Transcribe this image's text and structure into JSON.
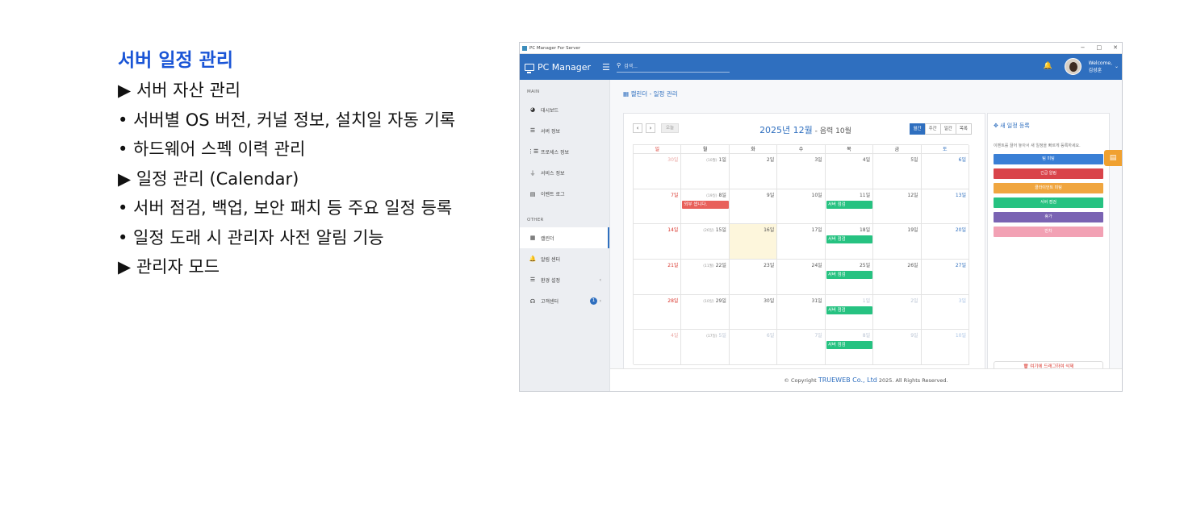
{
  "left_panel": {
    "title": "서버 일정 관리",
    "lines": [
      "▶ 서버 자산 관리",
      "• 서버별 OS 버전, 커널 정보, 설치일 자동 기록",
      "• 하드웨어 스펙 이력 관리",
      "▶ 일정 관리 (Calendar)",
      "• 서버 점검, 백업, 보안 패치 등 주요 일정 등록",
      "• 일정 도래 시 관리자 사전 알림 기능",
      "▶ 관리자 모드"
    ]
  },
  "window": {
    "title": "PC Manager For Server",
    "controls": [
      "−",
      "□",
      "✕"
    ]
  },
  "header": {
    "brand": "PC Manager",
    "search_placeholder": "검색...",
    "welcome": "Welcome,",
    "user": "김성훈"
  },
  "sidebar": {
    "main_label": "MAIN",
    "main_items": [
      {
        "label": "대시보드",
        "icon": "dashboard-icon",
        "glyph": "◕"
      },
      {
        "label": "서버 정보",
        "icon": "server-icon",
        "glyph": "☰"
      },
      {
        "label": "프로세스 정보",
        "icon": "list-icon",
        "glyph": "⋮☰"
      },
      {
        "label": "서비스 정보",
        "icon": "plug-icon",
        "glyph": "⏚"
      },
      {
        "label": "이벤트 로그",
        "icon": "log-icon",
        "glyph": "▤"
      }
    ],
    "other_label": "OTHER",
    "other_items": [
      {
        "label": "캘린더",
        "icon": "calendar-icon",
        "glyph": "▦",
        "active": true
      },
      {
        "label": "알림 센터",
        "icon": "bell-icon",
        "glyph": "🔔"
      },
      {
        "label": "환경 설정",
        "icon": "settings-icon",
        "glyph": "☰",
        "chevron": "‹"
      },
      {
        "label": "고객센터",
        "icon": "headset-icon",
        "glyph": "☊",
        "chevron": "‹",
        "badge": "1"
      }
    ]
  },
  "breadcrumb": "캘린더 - 일정 관리",
  "calendar": {
    "prev": "‹",
    "next": "›",
    "today": "오늘",
    "title": "2025년 12월",
    "lunar": " - 음력 10월",
    "views": [
      "월간",
      "주간",
      "일간",
      "목록"
    ],
    "active_view": "월간",
    "weekdays": [
      "일",
      "월",
      "화",
      "수",
      "목",
      "금",
      "토"
    ],
    "weeks": [
      [
        {
          "d": "30일",
          "om": true
        },
        {
          "d": "1일",
          "l": "(10월)"
        },
        {
          "d": "2일"
        },
        {
          "d": "3일"
        },
        {
          "d": "4일"
        },
        {
          "d": "5일"
        },
        {
          "d": "6일"
        }
      ],
      [
        {
          "d": "7일"
        },
        {
          "d": "8일",
          "l": "(19일)"
        },
        {
          "d": "9일"
        },
        {
          "d": "10일"
        },
        {
          "d": "11일"
        },
        {
          "d": "12일"
        },
        {
          "d": "13일"
        }
      ],
      [
        {
          "d": "14일"
        },
        {
          "d": "15일",
          "l": "(26일)"
        },
        {
          "d": "16일",
          "today": true
        },
        {
          "d": "17일"
        },
        {
          "d": "18일"
        },
        {
          "d": "19일"
        },
        {
          "d": "20일"
        }
      ],
      [
        {
          "d": "21일"
        },
        {
          "d": "22일",
          "l": "(11월)"
        },
        {
          "d": "23일"
        },
        {
          "d": "24일"
        },
        {
          "d": "25일"
        },
        {
          "d": "26일"
        },
        {
          "d": "27일"
        }
      ],
      [
        {
          "d": "28일"
        },
        {
          "d": "29일",
          "l": "(10일)"
        },
        {
          "d": "30일"
        },
        {
          "d": "31일"
        },
        {
          "d": "1일",
          "om": true
        },
        {
          "d": "2일",
          "om": true
        },
        {
          "d": "3일",
          "om": true
        }
      ],
      [
        {
          "d": "4일",
          "om": true
        },
        {
          "d": "5일",
          "l": "(17일)",
          "om": true
        },
        {
          "d": "6일",
          "om": true
        },
        {
          "d": "7일",
          "om": true
        },
        {
          "d": "8일",
          "om": true
        },
        {
          "d": "9일",
          "om": true
        },
        {
          "d": "10일",
          "om": true
        }
      ]
    ],
    "events": [
      {
        "label": "외부 셉니다.",
        "week": 1,
        "col": 1,
        "color": "#e8605a"
      },
      {
        "label": "서버 점검",
        "week": 1,
        "col": 4,
        "color": "#26c281"
      },
      {
        "label": "서버 점검",
        "week": 2,
        "col": 4,
        "color": "#26c281"
      },
      {
        "label": "서버 점검",
        "week": 3,
        "col": 4,
        "color": "#26c281"
      },
      {
        "label": "서버 점검",
        "week": 4,
        "col": 4,
        "color": "#26c281"
      },
      {
        "label": "서버 점검",
        "week": 5,
        "col": 4,
        "color": "#26c281"
      }
    ]
  },
  "right_panel": {
    "title": "✥ 새 일정 등록",
    "hint": "이벤트를 끌어 놓아서 새 일정을 빠르게 등록하세요.",
    "buttons": [
      {
        "label": "팀 미팅",
        "color": "#3a7fd5"
      },
      {
        "label": "긴급 알림",
        "color": "#d9444a"
      },
      {
        "label": "클라이언트 미팅",
        "color": "#f0a640"
      },
      {
        "label": "서버 점검",
        "color": "#26c281"
      },
      {
        "label": "휴가",
        "color": "#7a63b3"
      },
      {
        "label": "반차",
        "color": "#f2a1b4"
      }
    ],
    "trash": "🗑 여기에 드래그하여 삭제"
  },
  "footer": {
    "prefix": "© Copyright ",
    "company": "TRUEWEB Co., Ltd",
    "suffix": " 2025. All Rights Reserved."
  },
  "colors": {
    "primary": "#2f6fbf",
    "sunday": "#d9342b",
    "today_bg": "#fdf6dc",
    "accent": "#f0a130"
  }
}
